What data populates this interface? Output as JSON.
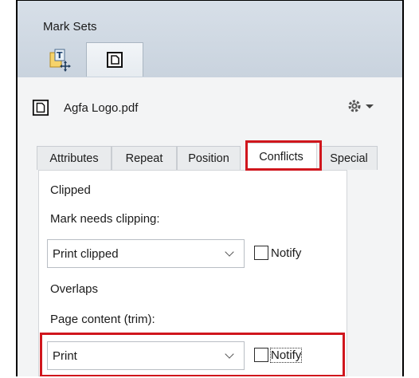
{
  "header": {
    "title": "Mark Sets",
    "tools": [
      {
        "name": "text-mark-tool",
        "icon": "text-mark-icon"
      },
      {
        "name": "page-mark-tool",
        "icon": "page-icon",
        "selected": true
      }
    ]
  },
  "file": {
    "name": "Agfa Logo.pdf",
    "icon": "pdf-page-icon",
    "menu_icon": "gear-icon"
  },
  "tabs": [
    {
      "label": "Attributes"
    },
    {
      "label": "Repeat"
    },
    {
      "label": "Position"
    },
    {
      "label": "Conflicts",
      "active": true
    },
    {
      "label": "Special"
    }
  ],
  "conflicts": {
    "clipped": {
      "heading": "Clipped",
      "field_label": "Mark needs clipping:",
      "value": "Print clipped",
      "notify_label": "Notify",
      "notify_checked": false
    },
    "overlaps": {
      "heading": "Overlaps",
      "field_label": "Page content (trim):",
      "value": "Print",
      "notify_label": "Notify",
      "notify_checked": false
    }
  },
  "colors": {
    "highlight": "#d0161d",
    "header_bg": "#d7dfe8"
  }
}
